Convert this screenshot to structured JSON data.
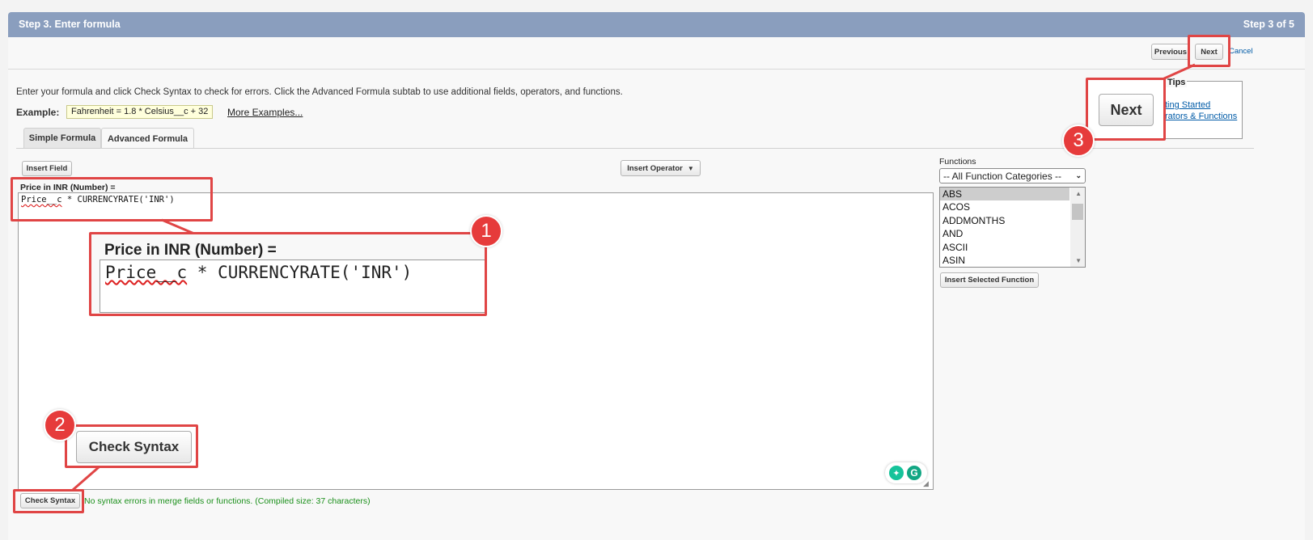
{
  "header": {
    "title": "Step 3. Enter formula",
    "step": "Step 3 of 5"
  },
  "nav": {
    "previous": "Previous",
    "next": "Next",
    "cancel": "Cancel"
  },
  "intro": "Enter your formula and click Check Syntax to check for errors. Click the Advanced Formula subtab to use additional fields, operators, and functions.",
  "example": {
    "label": "Example:",
    "value": "Fahrenheit = 1.8 * Celsius__c + 32",
    "more": "More Examples..."
  },
  "tabs": [
    {
      "label": "Simple Formula"
    },
    {
      "label": "Advanced Formula"
    }
  ],
  "editor": {
    "insert_field": "Insert Field",
    "insert_operator": "Insert Operator",
    "field_label": "Price in INR (Number) =",
    "formula_prefix": "Price__c",
    "formula_rest": " * CURRENCYRATE('INR')",
    "check_syntax": "Check Syntax",
    "result": "No syntax errors in merge fields or functions. (Compiled size: 37 characters)"
  },
  "functions": {
    "label": "Functions",
    "category": "-- All Function Categories --",
    "items": [
      "ABS",
      "ACOS",
      "ADDMONTHS",
      "AND",
      "ASCII",
      "ASIN"
    ],
    "selected": "ABS",
    "insert_selected": "Insert Selected Function"
  },
  "tips": {
    "title": "Tips",
    "links": [
      "Getting Started",
      "Operators & Functions"
    ],
    "visible": [
      "ting Started",
      "rators & Functions"
    ]
  },
  "callouts": {
    "one": {
      "badge": "1",
      "label": "Price in INR (Number) =",
      "code_prefix": "Price__c",
      "code_rest": " * CURRENCYRATE('INR')"
    },
    "two": {
      "badge": "2",
      "button": "Check Syntax"
    },
    "three": {
      "badge": "3",
      "button": "Next"
    }
  },
  "colors": {
    "header": "#8a9ebe",
    "callout_red": "#e04545",
    "success_green": "#1a8f1a"
  }
}
